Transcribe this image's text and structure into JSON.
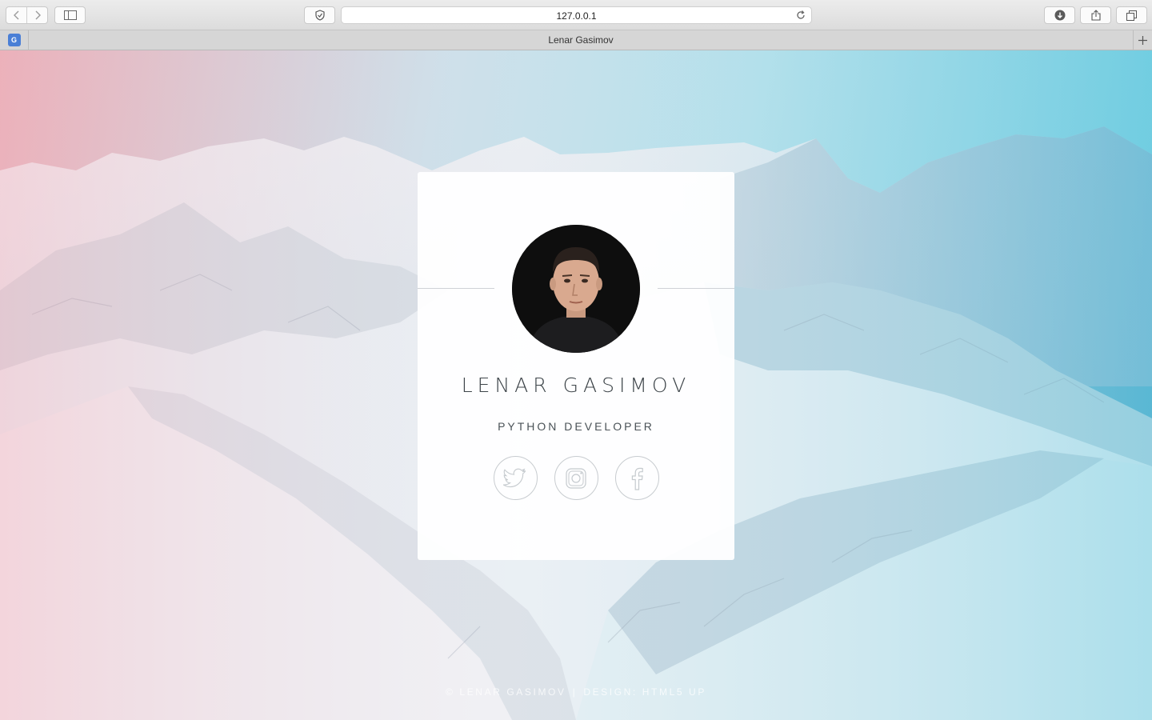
{
  "browser": {
    "url": "127.0.0.1",
    "tab_title": "Lenar Gasimov",
    "extension_badge": "G",
    "icons": [
      "chevron-left-icon",
      "chevron-right-icon",
      "sidebar-icon",
      "shield-icon",
      "reload-icon",
      "download-icon",
      "share-icon",
      "tabs-icon",
      "plus-icon"
    ]
  },
  "profile": {
    "name": "LENAR GASIMOV",
    "role": "PYTHON DEVELOPER",
    "socials": [
      {
        "icon": "twitter-icon"
      },
      {
        "icon": "instagram-icon"
      },
      {
        "icon": "facebook-icon"
      }
    ]
  },
  "footer": {
    "copyright": "© LENAR GASIMOV",
    "separator": "|",
    "credit": "DESIGN: HTML5 UP"
  },
  "colors": {
    "accent": "#6fcde0",
    "text_dark": "#3d4449",
    "card_bg": "#ffffff"
  }
}
